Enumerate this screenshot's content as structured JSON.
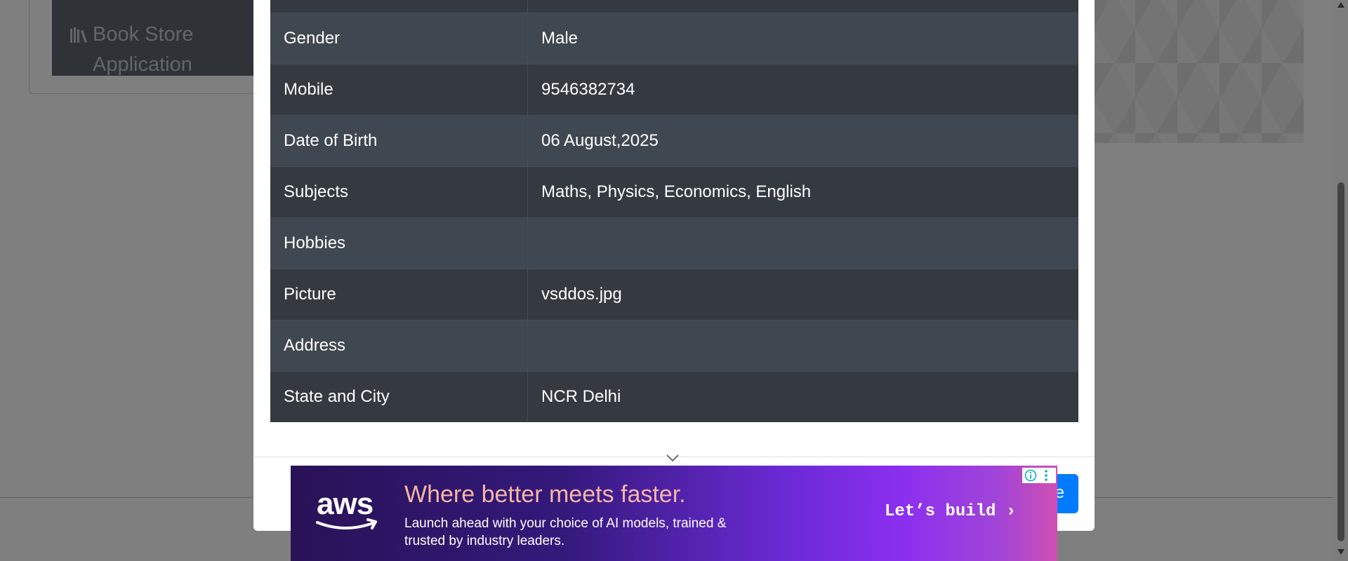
{
  "background": {
    "sidebar_item_label": "Book Store Application"
  },
  "modal": {
    "rows": [
      {
        "label": "",
        "value": ""
      },
      {
        "label": "Gender",
        "value": "Male"
      },
      {
        "label": "Mobile",
        "value": "9546382734"
      },
      {
        "label": "Date of Birth",
        "value": "06 August,2025"
      },
      {
        "label": "Subjects",
        "value": "Maths, Physics, Economics, English"
      },
      {
        "label": "Hobbies",
        "value": ""
      },
      {
        "label": "Picture",
        "value": "vsddos.jpg"
      },
      {
        "label": "Address",
        "value": ""
      },
      {
        "label": "State and City",
        "value": "NCR Delhi"
      }
    ],
    "close_label": "e"
  },
  "ad": {
    "brand": "aws",
    "headline": "Where better meets faster.",
    "subtext": "Launch ahead with your choice of AI models, trained & trusted by industry leaders.",
    "cta": "Let’s build ›"
  },
  "colors": {
    "table_dark": "#343a40",
    "table_striped": "#3f4750",
    "primary_button": "#007bff",
    "ad_headline": "#f7b5a8"
  },
  "icons": [
    "books-icon",
    "chevron-down-icon",
    "aws-logo-icon",
    "info-icon",
    "kebab-menu-icon",
    "scroll-up-arrow-icon",
    "scroll-down-arrow-icon"
  ]
}
